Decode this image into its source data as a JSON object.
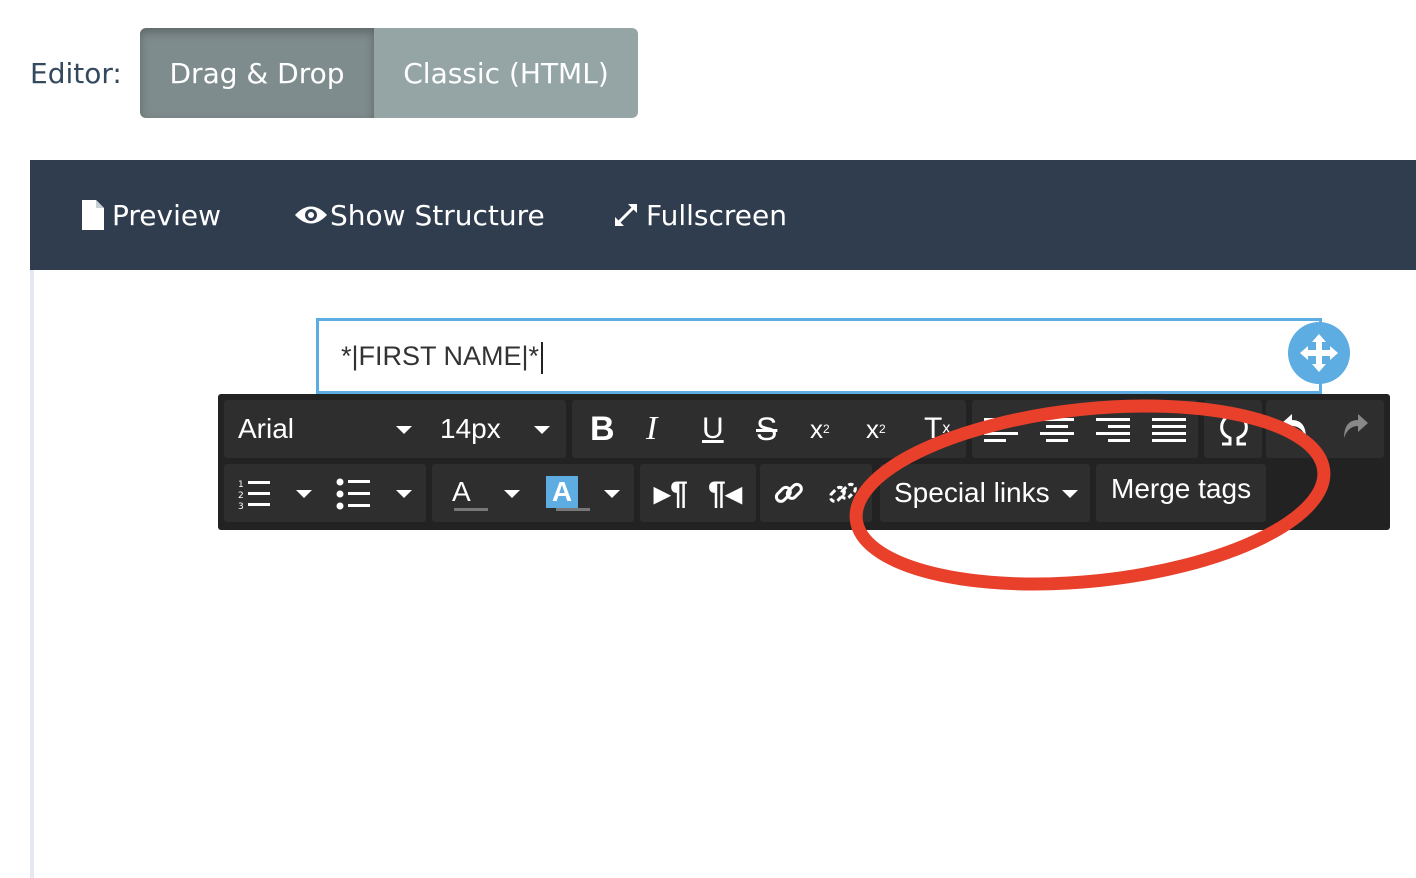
{
  "editor": {
    "label": "Editor:",
    "modes": [
      {
        "label": "Drag & Drop",
        "active": true
      },
      {
        "label": "Classic (HTML)",
        "active": false
      }
    ]
  },
  "nav": {
    "preview": "Preview",
    "show_structure": "Show Structure",
    "fullscreen": "Fullscreen"
  },
  "content": {
    "text": "*|FIRST NAME|*"
  },
  "toolbar": {
    "font_family": "Arial",
    "font_size": "14px",
    "color_letter": "A",
    "bg_color_letter": "A",
    "special_links": "Special links",
    "merge_tags": "Merge tags"
  },
  "colors": {
    "nav_bg": "#2f3d4f",
    "toolbar_bg": "#222222",
    "accent": "#5dade2",
    "highlight": "#e8402a"
  }
}
